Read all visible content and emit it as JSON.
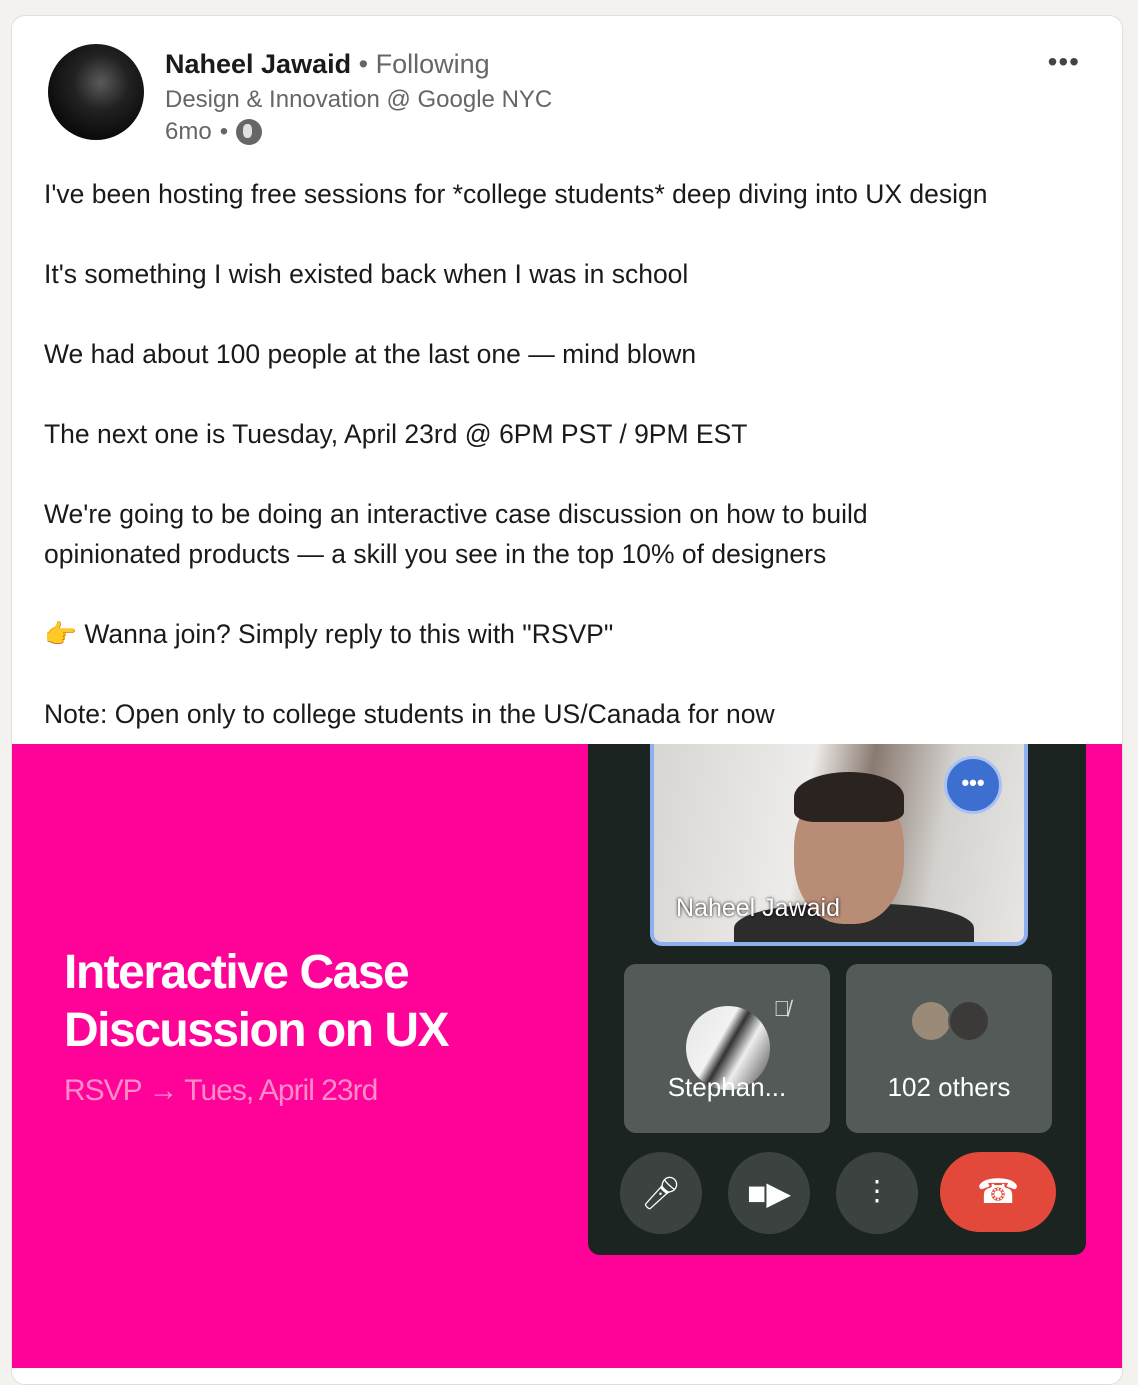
{
  "post": {
    "author": "Naheel Jawaid",
    "following": "Following",
    "headline": "Design & Innovation @ Google NYC",
    "age": "6mo",
    "visibility_icon": "globe-icon",
    "more_icon": "•••",
    "paragraphs": [
      "I've been hosting free sessions for *college students* deep diving into UX design",
      "It's something I wish existed back when I was in school",
      "We had about 100 people at the last one — mind blown",
      "The next one is Tuesday, April 23rd @ 6PM PST / 9PM EST",
      "We're going to be doing an interactive case discussion on how to build opinionated products — a skill you see in the top 10% of designers",
      "👉 Wanna join? Simply reply to this with \"RSVP\"",
      "Note: Open only to college students in the US/Canada for now"
    ]
  },
  "image": {
    "title_line1": "Interactive Case",
    "title_line2": "Discussion on UX",
    "rsvp": "RSVP → Tues, April 23rd",
    "background": "#ff0399",
    "call": {
      "main_participant": "Naheel Jawaid",
      "tile1": "Stephan...",
      "tile2": "102 others",
      "end_color": "#e2493b"
    }
  }
}
